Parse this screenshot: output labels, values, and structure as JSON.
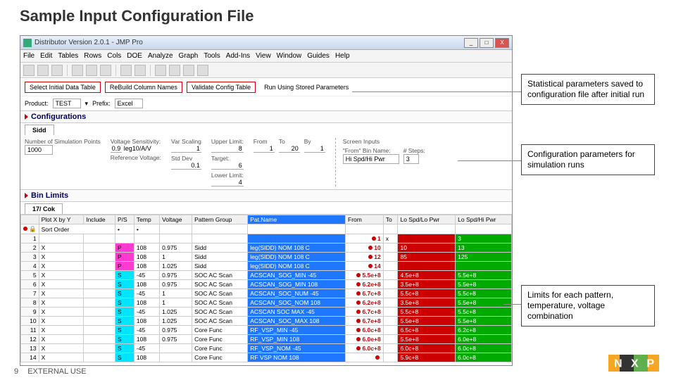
{
  "slide": {
    "title": "Sample Input Configuration File",
    "page": "9",
    "footer_label": "EXTERNAL USE"
  },
  "window": {
    "title": "Distributor Version 2.0.1 - JMP Pro"
  },
  "menus": [
    "File",
    "Edit",
    "Tables",
    "Rows",
    "Cols",
    "DOE",
    "Analyze",
    "Graph",
    "Tools",
    "Add-Ins",
    "View",
    "Window",
    "Guides",
    "Help"
  ],
  "buttons": {
    "select_table": "Select Initial Data Table",
    "rebuild_cols": "ReBuild Column Names",
    "validate": "Validate Config Table",
    "run_stored": "Run Using Stored Parameters"
  },
  "product_row": {
    "product_label": "Product:",
    "product_value": "TEST",
    "prefix_label": "Prefix:",
    "prefix_value": "Excel"
  },
  "sections": {
    "configurations": "Configurations",
    "bin_limits": "Bin Limits"
  },
  "tabs": {
    "sidd": "Sidd",
    "main_tab": "17/ Cok"
  },
  "config": {
    "num_points_label": "Number of\nSimulation\nPoints",
    "num_points": "1000",
    "vs_label": "Voltage Sensitivity:",
    "vs": "0.9",
    "units": "leg10/A/V",
    "ref_v_label": "Reference Voltage:",
    "var_scale_label": "Var Scaling",
    "var_scale": "1",
    "stddev_label": "Std Dev",
    "stddev": "0.1",
    "upper_label": "Upper Limit:",
    "upper": "8",
    "target_label": "Target:",
    "target": "6",
    "lower_label": "Lower Limit:",
    "lower": "4",
    "from_label": "From",
    "from": "1",
    "to_label": "To",
    "to": "20",
    "by_label": "By",
    "by": "1",
    "screen_label": "Screen Inputs",
    "from_bin_label": "\"From\" Bin Name:",
    "from_bin": "Hi Spd/Hi Pwr",
    "steps_label": "# Steps:",
    "steps": "3"
  },
  "table": {
    "headers": [
      "",
      "Plot X by Y",
      "Include",
      "P/S",
      "Temp",
      "Voltage",
      "Pattern Group",
      "Pat.Name",
      "From",
      "To",
      "Lo Spd/Lo Pwr",
      "Lo Spd/Hi Pwr"
    ],
    "sort_row": {
      "label": "Sort Order"
    },
    "rows": [
      {
        "n": "1",
        "x": "",
        "inc": "",
        "ps": "",
        "temp": "",
        "volt": "",
        "grp": "",
        "pat": "",
        "from": "1",
        "to": "x",
        "lo1": "",
        "lo2": "3"
      },
      {
        "n": "2",
        "x": "X",
        "inc": "",
        "ps": "P",
        "temp": "108",
        "volt": "0.975",
        "grp": "Sidd",
        "pat": "leg(SIDD) NOM 108 C",
        "from": "10",
        "to": "",
        "lo1": "10",
        "lo2": "13"
      },
      {
        "n": "3",
        "x": "X",
        "inc": "",
        "ps": "P",
        "temp": "108",
        "volt": "1",
        "grp": "Sidd",
        "pat": "leg(SIDD) NOM 108 C",
        "from": "12",
        "to": "",
        "lo1": "85",
        "lo2": "125"
      },
      {
        "n": "4",
        "x": "X",
        "inc": "",
        "ps": "P",
        "temp": "108",
        "volt": "1.025",
        "grp": "Sidd",
        "pat": "leg(SIDD) NOM 108 C",
        "from": "14",
        "to": "",
        "lo1": "",
        "lo2": ""
      },
      {
        "n": "5",
        "x": "X",
        "inc": "",
        "ps": "S",
        "temp": "-45",
        "volt": "0.975",
        "grp": "SOC AC Scan",
        "pat": "ACSCAN_SOG_MIN -45",
        "from": "5.5e+8",
        "to": "",
        "lo1": "4.5e+8",
        "lo2": "5.5e+8"
      },
      {
        "n": "6",
        "x": "X",
        "inc": "",
        "ps": "S",
        "temp": "108",
        "volt": "0.975",
        "grp": "SOC AC Scan",
        "pat": "ACSCAN_SOG_MIN 108",
        "from": "6.2e+8",
        "to": "",
        "lo1": "3.5e+8",
        "lo2": "5.5e+8"
      },
      {
        "n": "7",
        "x": "X",
        "inc": "",
        "ps": "S",
        "temp": "-45",
        "volt": "1",
        "grp": "SOC AC Scan",
        "pat": "ACSCAN_SOC_NUM -45",
        "from": "6.7c+8",
        "to": "",
        "lo1": "5.5c+8",
        "lo2": "5.5c+8"
      },
      {
        "n": "8",
        "x": "X",
        "inc": "",
        "ps": "S",
        "temp": "108",
        "volt": "1",
        "grp": "SOC AC Scan",
        "pat": "ACSCAN_SOC_NOM 108",
        "from": "6.2e+8",
        "to": "",
        "lo1": "3.5e+8",
        "lo2": "5.5e+8"
      },
      {
        "n": "9",
        "x": "X",
        "inc": "",
        "ps": "S",
        "temp": "-45",
        "volt": "1.025",
        "grp": "SOC AC Scan",
        "pat": "ACSCAN SOC MAX -45",
        "from": "6.7c+8",
        "to": "",
        "lo1": "5.5c+8",
        "lo2": "5.5c+8"
      },
      {
        "n": "10",
        "x": "X",
        "inc": "",
        "ps": "S",
        "temp": "108",
        "volt": "1.025",
        "grp": "SOC AC Scan",
        "pat": "ACSCAN_SOC_MAX 108",
        "from": "6.7e+8",
        "to": "",
        "lo1": "5.5e+8",
        "lo2": "5.5e+8"
      },
      {
        "n": "11",
        "x": "X",
        "inc": "",
        "ps": "S",
        "temp": "-45",
        "volt": "0.975",
        "grp": "Core Func",
        "pat": "RF_VSP_MIN -45",
        "from": "6.0c+8",
        "to": "",
        "lo1": "6.5c+8",
        "lo2": "6.2c+8"
      },
      {
        "n": "12",
        "x": "X",
        "inc": "",
        "ps": "S",
        "temp": "108",
        "volt": "0.975",
        "grp": "Core Func",
        "pat": "RF_VSP_MIN 108",
        "from": "6.0e+8",
        "to": "",
        "lo1": "5.5e+8",
        "lo2": "6.0e+8"
      },
      {
        "n": "13",
        "x": "X",
        "inc": "",
        "ps": "S",
        "temp": "-45",
        "volt": "",
        "grp": "Core Func",
        "pat": "RF_VSP_NOM -45",
        "from": "6.0c+8",
        "to": "",
        "lo1": "6.0c+8",
        "lo2": "6.0c+8"
      },
      {
        "n": "14",
        "x": "X",
        "inc": "",
        "ps": "S",
        "temp": "108",
        "volt": "",
        "grp": "Core Func",
        "pat": "RF VSP NOM 108",
        "from": "",
        "to": "",
        "lo1": "5.9c+8",
        "lo2": "6.0c+8"
      }
    ]
  },
  "callouts": {
    "c1": "Statistical parameters saved to configuration file after initial run",
    "c2": "Configuration parameters for simulation runs",
    "c3": "Limits for each pattern, temperature, voltage combination"
  }
}
